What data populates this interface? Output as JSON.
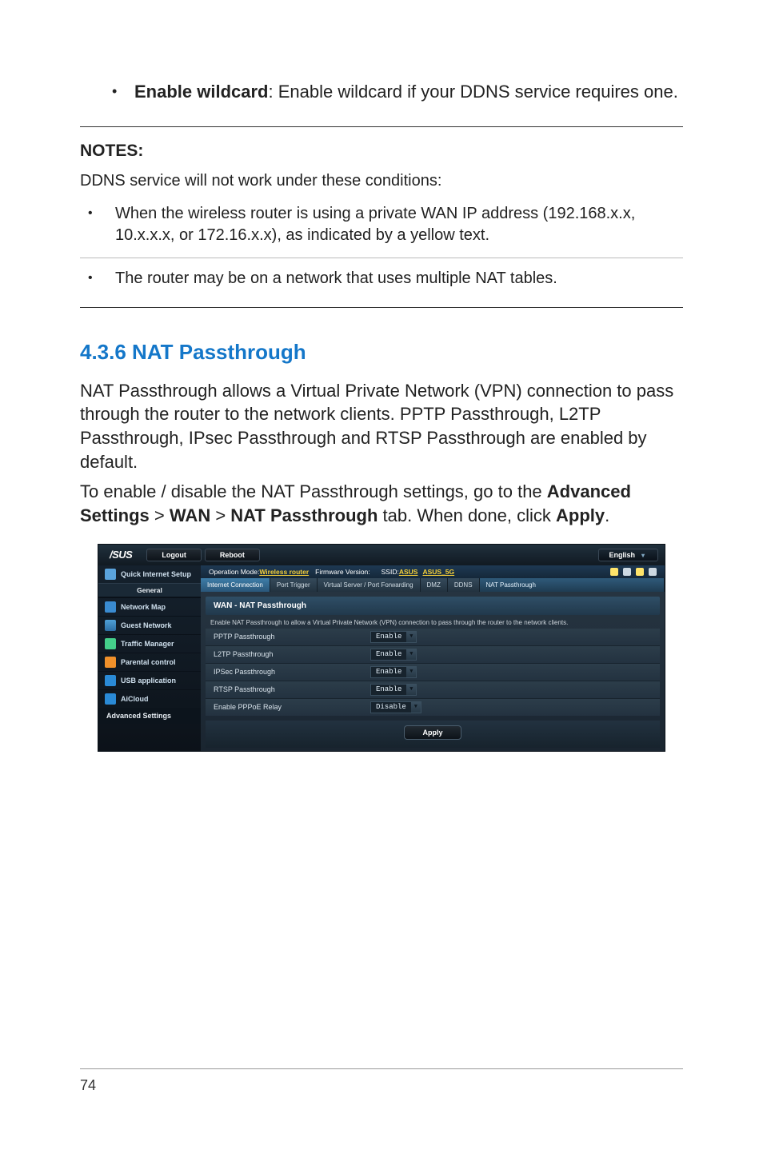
{
  "bullet_enable_wildcard": {
    "term": "Enable wildcard",
    "desc": ": Enable wildcard if your DDNS service requires one."
  },
  "notes": {
    "title": "NOTES",
    "colon": ":",
    "intro": "DDNS service will not work under these conditions:",
    "items": [
      "When the wireless router is using a private WAN IP address (192.168.x.x, 10.x.x.x, or 172.16.x.x), as indicated by a yellow text.",
      "The router may be on a network that uses multiple NAT tables."
    ]
  },
  "section_heading": "4.3.6 NAT Passthrough",
  "section_para1": "NAT Passthrough allows a Virtual Private Network (VPN) connection to pass through the router to the network clients. PPTP Passthrough, L2TP Passthrough, IPsec Passthrough and RTSP Passthrough are enabled by default.",
  "section_para2_prefix": "To enable / disable the NAT Passthrough settings, go to the ",
  "section_para2_bold1": "Advanced Settings",
  "section_para2_gt1": " > ",
  "section_para2_bold2": "WAN",
  "section_para2_gt2": " > ",
  "section_para2_bold3": "NAT Passthrough",
  "section_para2_mid": " tab. When done, click ",
  "section_para2_bold4": "Apply",
  "section_para2_end": ".",
  "page_number": "74",
  "router": {
    "brand": "/SUS",
    "logout": "Logout",
    "reboot": "Reboot",
    "language": "English",
    "op_mode_label": "Operation Mode: ",
    "op_mode_value": "Wireless router",
    "fw_label": "Firmware Version:",
    "ssid_label": "SSID: ",
    "ssid1": "ASUS",
    "ssid2": "ASUS_5G",
    "sidebar": {
      "quick_internet_setup": "Quick Internet Setup",
      "general": "General",
      "items": [
        "Network Map",
        "Guest Network",
        "Traffic Manager",
        "Parental control",
        "USB application",
        "AiCloud"
      ],
      "advanced": "Advanced Settings"
    },
    "tabs": [
      "Internet Connection",
      "Port Trigger",
      "Virtual Server / Port Forwarding",
      "DMZ",
      "DDNS",
      "NAT Passthrough"
    ],
    "panel_title": "WAN - NAT Passthrough",
    "panel_desc": "Enable NAT Passthrough to allow a Virtual Private Network (VPN) connection to pass through the router to the network clients.",
    "rows": [
      {
        "label": "PPTP Passthrough",
        "value": "Enable"
      },
      {
        "label": "L2TP Passthrough",
        "value": "Enable"
      },
      {
        "label": "IPSec Passthrough",
        "value": "Enable"
      },
      {
        "label": "RTSP Passthrough",
        "value": "Enable"
      },
      {
        "label": "Enable PPPoE Relay",
        "value": "Disable"
      }
    ],
    "apply": "Apply"
  }
}
